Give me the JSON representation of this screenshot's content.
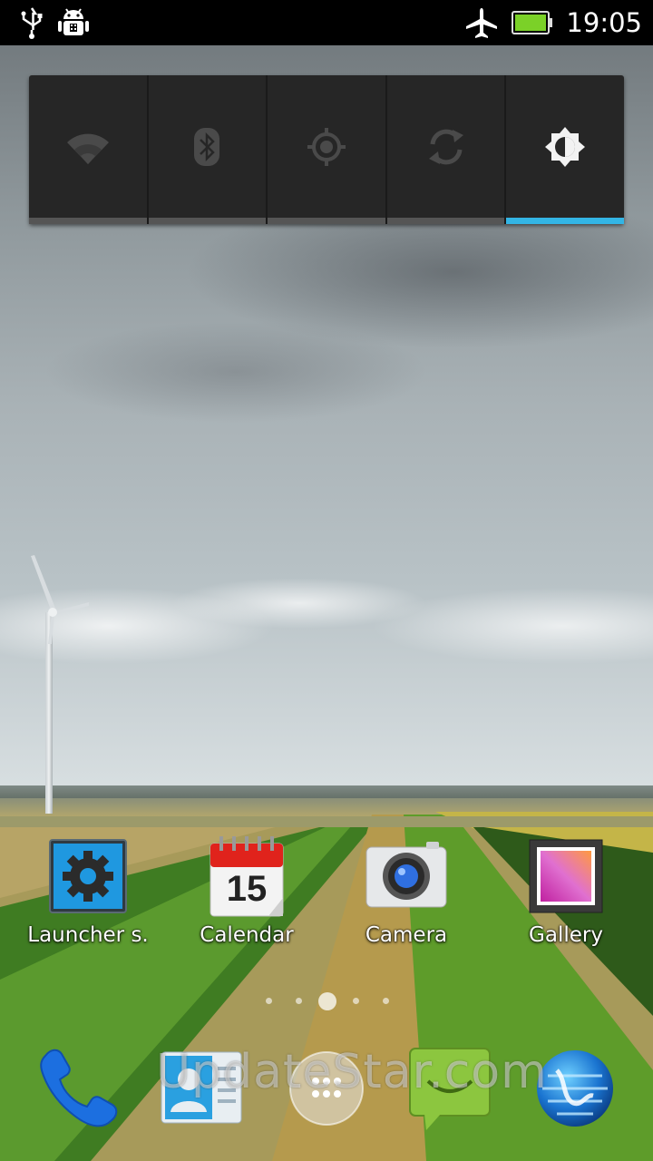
{
  "status_bar": {
    "time": "19:05",
    "left_icons": [
      "usb-icon",
      "android-debug-icon"
    ],
    "right_icons": [
      "airplane-mode-icon",
      "battery-icon"
    ]
  },
  "quick_settings": {
    "toggles": [
      {
        "name": "wifi",
        "icon": "wifi-icon",
        "on": false
      },
      {
        "name": "bluetooth",
        "icon": "bluetooth-icon",
        "on": false
      },
      {
        "name": "gps",
        "icon": "gps-icon",
        "on": false
      },
      {
        "name": "sync",
        "icon": "sync-icon",
        "on": false
      },
      {
        "name": "brightness",
        "icon": "brightness-icon",
        "on": true
      }
    ],
    "accent_color": "#33b5e5"
  },
  "home_apps": [
    {
      "label": "Launcher s.",
      "icon": "gear-icon"
    },
    {
      "label": "Calendar",
      "icon": "calendar-icon",
      "date": "15"
    },
    {
      "label": "Camera",
      "icon": "camera-icon"
    },
    {
      "label": "Gallery",
      "icon": "gallery-icon"
    }
  ],
  "page_indicator": {
    "count": 5,
    "current": 3
  },
  "dock": [
    {
      "name": "phone",
      "icon": "phone-icon"
    },
    {
      "name": "contacts",
      "icon": "contacts-icon"
    },
    {
      "name": "app-drawer",
      "icon": "app-drawer-icon"
    },
    {
      "name": "messaging",
      "icon": "messaging-icon"
    },
    {
      "name": "browser",
      "icon": "globe-icon"
    }
  ],
  "watermark": "UpdateStar.com"
}
